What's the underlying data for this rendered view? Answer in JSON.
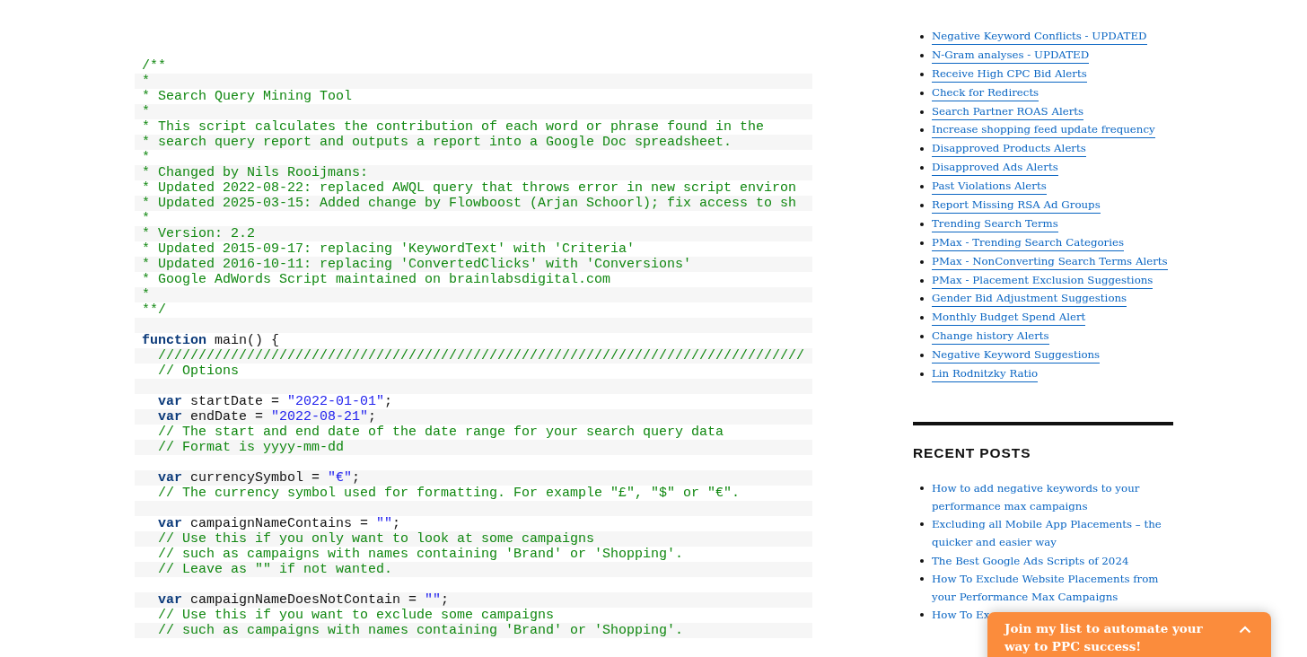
{
  "code_lines": [
    {
      "kind": "code",
      "segments": [
        {
          "kind": "comment",
          "text": "/**"
        }
      ]
    },
    {
      "kind": "code",
      "segments": [
        {
          "kind": "comment",
          "text": "*"
        }
      ]
    },
    {
      "kind": "code",
      "segments": [
        {
          "kind": "comment",
          "text": "* Search Query Mining Tool"
        }
      ]
    },
    {
      "kind": "code",
      "segments": [
        {
          "kind": "comment",
          "text": "*"
        }
      ]
    },
    {
      "kind": "code",
      "segments": [
        {
          "kind": "comment",
          "text": "* This script calculates the contribution of each word or phrase found in the"
        }
      ]
    },
    {
      "kind": "code",
      "segments": [
        {
          "kind": "comment",
          "text": "* search query report and outputs a report into a Google Doc spreadsheet."
        }
      ]
    },
    {
      "kind": "code",
      "segments": [
        {
          "kind": "comment",
          "text": "*"
        }
      ]
    },
    {
      "kind": "code",
      "segments": [
        {
          "kind": "comment",
          "text": "* Changed by Nils Rooijmans:"
        }
      ]
    },
    {
      "kind": "code",
      "segments": [
        {
          "kind": "comment",
          "text": "* Updated 2022-08-22: replaced AWQL query that throws error in new script environ"
        }
      ]
    },
    {
      "kind": "code",
      "segments": [
        {
          "kind": "comment",
          "text": "* Updated 2025-03-15: Added change by Flowboost (Arjan Schoorl); fix access to sh"
        }
      ]
    },
    {
      "kind": "code",
      "segments": [
        {
          "kind": "comment",
          "text": "*"
        }
      ]
    },
    {
      "kind": "code",
      "segments": [
        {
          "kind": "comment",
          "text": "* Version: 2.2"
        }
      ]
    },
    {
      "kind": "code",
      "segments": [
        {
          "kind": "comment",
          "text": "* Updated 2015-09-17: replacing 'KeywordText' with 'Criteria'"
        }
      ]
    },
    {
      "kind": "code",
      "segments": [
        {
          "kind": "comment",
          "text": "* Updated 2016-10-11: replacing 'ConvertedClicks' with 'Conversions'"
        }
      ]
    },
    {
      "kind": "code",
      "segments": [
        {
          "kind": "comment",
          "text": "* Google AdWords Script maintained on brainlabsdigital.com"
        }
      ]
    },
    {
      "kind": "code",
      "segments": [
        {
          "kind": "comment",
          "text": "*"
        }
      ]
    },
    {
      "kind": "code",
      "segments": [
        {
          "kind": "comment",
          "text": "**/"
        }
      ]
    },
    {
      "kind": "blank"
    },
    {
      "kind": "code",
      "segments": [
        {
          "kind": "keyword",
          "text": "function"
        },
        {
          "kind": "plain",
          "text": " main() {"
        }
      ]
    },
    {
      "kind": "code",
      "segments": [
        {
          "kind": "comment",
          "text": "  ////////////////////////////////////////////////////////////////////////////////"
        }
      ]
    },
    {
      "kind": "code",
      "segments": [
        {
          "kind": "comment",
          "text": "  // Options"
        }
      ]
    },
    {
      "kind": "blank"
    },
    {
      "kind": "code",
      "segments": [
        {
          "kind": "keyword",
          "text": "  var"
        },
        {
          "kind": "plain",
          "text": " startDate = "
        },
        {
          "kind": "string",
          "text": "\"2022-01-01\""
        },
        {
          "kind": "plain",
          "text": ";"
        }
      ]
    },
    {
      "kind": "code",
      "segments": [
        {
          "kind": "keyword",
          "text": "  var"
        },
        {
          "kind": "plain",
          "text": " endDate = "
        },
        {
          "kind": "string",
          "text": "\"2022-08-21\""
        },
        {
          "kind": "plain",
          "text": ";"
        }
      ]
    },
    {
      "kind": "code",
      "segments": [
        {
          "kind": "comment",
          "text": "  // The start and end date of the date range for your search query data"
        }
      ]
    },
    {
      "kind": "code",
      "segments": [
        {
          "kind": "comment",
          "text": "  // Format is yyyy-mm-dd"
        }
      ]
    },
    {
      "kind": "blank"
    },
    {
      "kind": "code",
      "segments": [
        {
          "kind": "keyword",
          "text": "  var"
        },
        {
          "kind": "plain",
          "text": " currencySymbol = "
        },
        {
          "kind": "string",
          "text": "\"€\""
        },
        {
          "kind": "plain",
          "text": ";"
        }
      ]
    },
    {
      "kind": "code",
      "segments": [
        {
          "kind": "comment",
          "text": "  // The currency symbol used for formatting. For example \"£\", \"$\" or \"€\"."
        }
      ]
    },
    {
      "kind": "blank"
    },
    {
      "kind": "code",
      "segments": [
        {
          "kind": "keyword",
          "text": "  var"
        },
        {
          "kind": "plain",
          "text": " campaignNameContains = "
        },
        {
          "kind": "string",
          "text": "\"\""
        },
        {
          "kind": "plain",
          "text": ";"
        }
      ]
    },
    {
      "kind": "code",
      "segments": [
        {
          "kind": "comment",
          "text": "  // Use this if you only want to look at some campaigns"
        }
      ]
    },
    {
      "kind": "code",
      "segments": [
        {
          "kind": "comment",
          "text": "  // such as campaigns with names containing 'Brand' or 'Shopping'."
        }
      ]
    },
    {
      "kind": "code",
      "segments": [
        {
          "kind": "comment",
          "text": "  // Leave as \"\" if not wanted."
        }
      ]
    },
    {
      "kind": "blank"
    },
    {
      "kind": "code",
      "segments": [
        {
          "kind": "keyword",
          "text": "  var"
        },
        {
          "kind": "plain",
          "text": " campaignNameDoesNotContain = "
        },
        {
          "kind": "string",
          "text": "\"\""
        },
        {
          "kind": "plain",
          "text": ";"
        }
      ]
    },
    {
      "kind": "code",
      "segments": [
        {
          "kind": "comment",
          "text": "  // Use this if you want to exclude some campaigns"
        }
      ]
    },
    {
      "kind": "code",
      "segments": [
        {
          "kind": "comment",
          "text": "  // such as campaigns with names containing 'Brand' or 'Shopping'."
        }
      ]
    }
  ],
  "script_links": [
    "Negative Keyword Conflicts - UPDATED",
    "N-Gram analyses - UPDATED",
    "Receive High CPC Bid Alerts",
    "Check for Redirects",
    "Search Partner ROAS Alerts",
    "Increase shopping feed update frequency",
    "Disapproved Products Alerts",
    "Disapproved Ads Alerts",
    "Past Violations Alerts",
    "Report Missing RSA Ad Groups",
    "Trending Search Terms",
    "PMax - Trending Search Categories",
    "PMax - NonConverting Search Terms Alerts",
    "PMax - Placement Exclusion Suggestions",
    "Gender Bid Adjustment Suggestions",
    "Monthly Budget Spend Alert",
    "Change history Alerts",
    "Negative Keyword Suggestions",
    "Lin Rodnitzky Ratio"
  ],
  "recent_posts": {
    "title": "RECENT POSTS",
    "items": [
      "How to add negative keywords to your performance max campaigns",
      "Excluding all Mobile App Placements – the quicker and easier way",
      "The Best Google Ads Scripts of 2024",
      "How To Exclude Website Placements from your Performance Max Campaigns",
      "How To Ex"
    ]
  },
  "signup_popup": {
    "text": "Join my list to automate your way to PPC success!"
  }
}
